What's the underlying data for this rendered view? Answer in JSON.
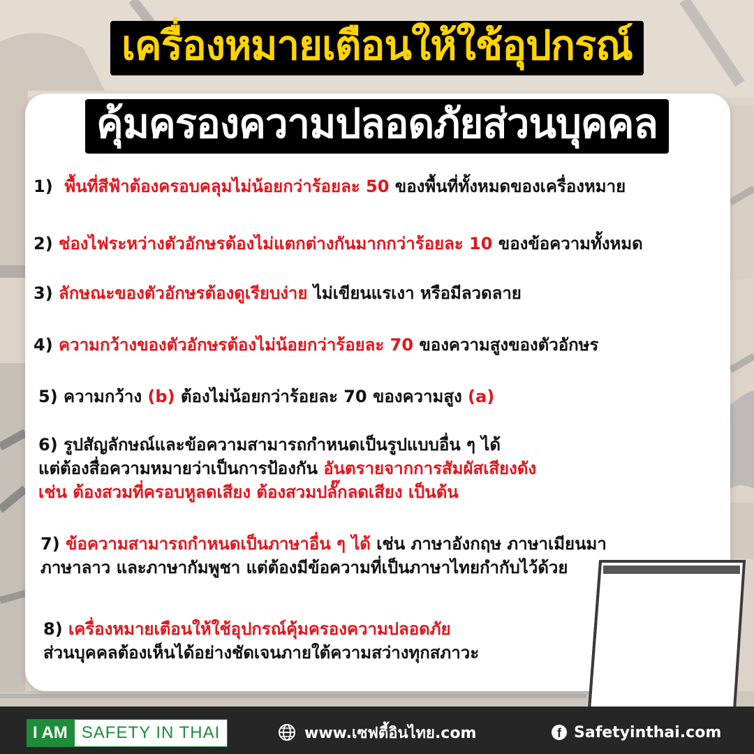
{
  "title": {
    "line1": "เครื่องหมายเตือนให้ใช้อุปกรณ์",
    "line2": "คุ้มครองความปลอดภัยส่วนบุคคล"
  },
  "items": [
    {
      "num": "1)",
      "red": "พื้นที่สีฟ้าต้องครอบคลุมไม่น้อยกว่าร้อยละ 50",
      "text": " ของพื้นที่ทั้งหมดของเครื่องหมาย"
    },
    {
      "num": "2)",
      "red": "ช่องไฟระหว่างตัวอักษรต้องไม่แตกต่างกันมากกว่าร้อยละ 10",
      "text": " ของข้อความทั้งหมด"
    },
    {
      "num": "3)",
      "red": "ลักษณะของตัวอักษรต้องดูเรียบง่าย",
      "text": " ไม่เขียนแรเงา หรือมีลวดลาย"
    },
    {
      "num": "4)",
      "red": "ความกว้างของตัวอักษรต้องไม่น้อยกว่าร้อยละ 70",
      "text": " ของความสูงของตัวอักษร"
    },
    {
      "num": "5)",
      "text_a": "ความกว้าง ",
      "red_a": "(b)",
      "text_b": " ต้องไม่น้อยกว่าร้อยละ 70 ของความสูง ",
      "red_b": "(a)"
    },
    {
      "num": "6)",
      "line1": "รูปสัญลักษณ์และข้อความสามารถกำหนดเป็นรูปแบบอื่น ๆ ได้",
      "line2": "แต่ต้องสื่อความหมายว่าเป็นการป้องกัน ",
      "line2_red": "อันตรายจากการสัมผัสเสียงดัง",
      "line3_red": "เช่น ต้องสวมที่ครอบหูลดเสียง ต้องสวมปลั๊กลดเสียง เป็นต้น"
    },
    {
      "num": "7)",
      "red": "ข้อความสามารถกำหนดเป็นภาษาอื่น ๆ ได้",
      "text": " เช่น ภาษาอังกฤษ ภาษาเมียนมา",
      "line2": "ภาษาลาว และภาษากัมพูชา แต่ต้องมีข้อความที่เป็นภาษาไทยกำกับไว้ด้วย"
    },
    {
      "num": "8)",
      "red": "เครื่องหมายเตือนให้ใช้อุปกรณ์คุ้มครองความปลอดภัย",
      "line2": "ส่วนบุคคลต้องเห็นได้อย่างชัดเจนภายใต้ความสว่างทุกสภาวะ"
    }
  ],
  "footer": {
    "logo_a": "I AM",
    "logo_b": "SAFETY IN THAI",
    "website": "www.เซฟตี้อินไทย.com",
    "facebook_icon": "f",
    "facebook": "Safetyinthai.com"
  },
  "colors": {
    "accent_red": "#e5141b",
    "title_yellow": "#ffd500",
    "brand_green": "#1e8c3a",
    "footer_bg": "#262626"
  }
}
